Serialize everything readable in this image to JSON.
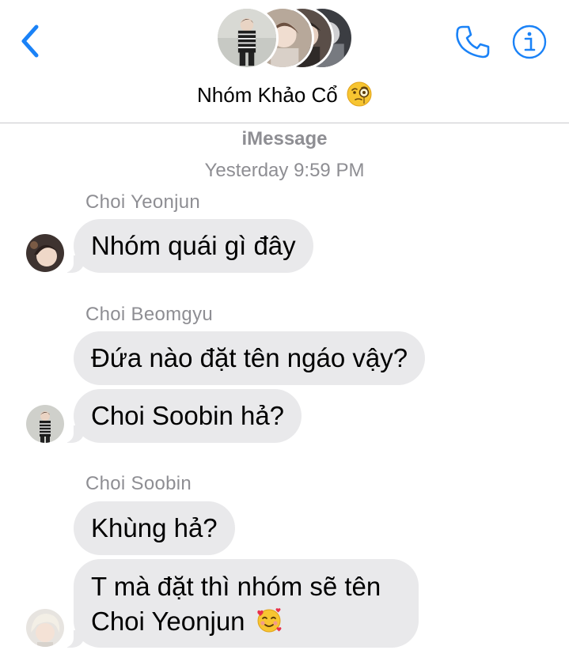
{
  "header": {
    "group_name": "Nhóm Khảo Cổ",
    "title_emoji": "face-with-monocle-emoji",
    "back_icon": "chevron-left-icon",
    "phone_icon": "phone-icon",
    "info_icon": "info-icon",
    "group_avatars": [
      "member-avatar-1",
      "member-avatar-2",
      "member-avatar-3",
      "member-avatar-4"
    ]
  },
  "thread": {
    "service": "iMessage",
    "timestamp": "Yesterday 9:59 PM"
  },
  "messages": [
    {
      "sender": "Choi Yeonjun",
      "bubbles": [
        "Nhóm quái gì đây"
      ]
    },
    {
      "sender": "Choi Beomgyu",
      "bubbles": [
        "Đứa nào đặt tên ngáo vậy?",
        "Choi Soobin hả?"
      ]
    },
    {
      "sender": "Choi Soobin",
      "bubbles": [
        "Khùng hả?",
        "T mà đặt thì nhóm sẽ tên",
        "Choi Yeonjun"
      ],
      "last_emoji": "smiling-face-with-hearts-emoji"
    }
  ],
  "colors": {
    "accent": "#1a82f7",
    "bubble_gray": "#e9e9eb",
    "secondary_text": "#8e8e93"
  }
}
